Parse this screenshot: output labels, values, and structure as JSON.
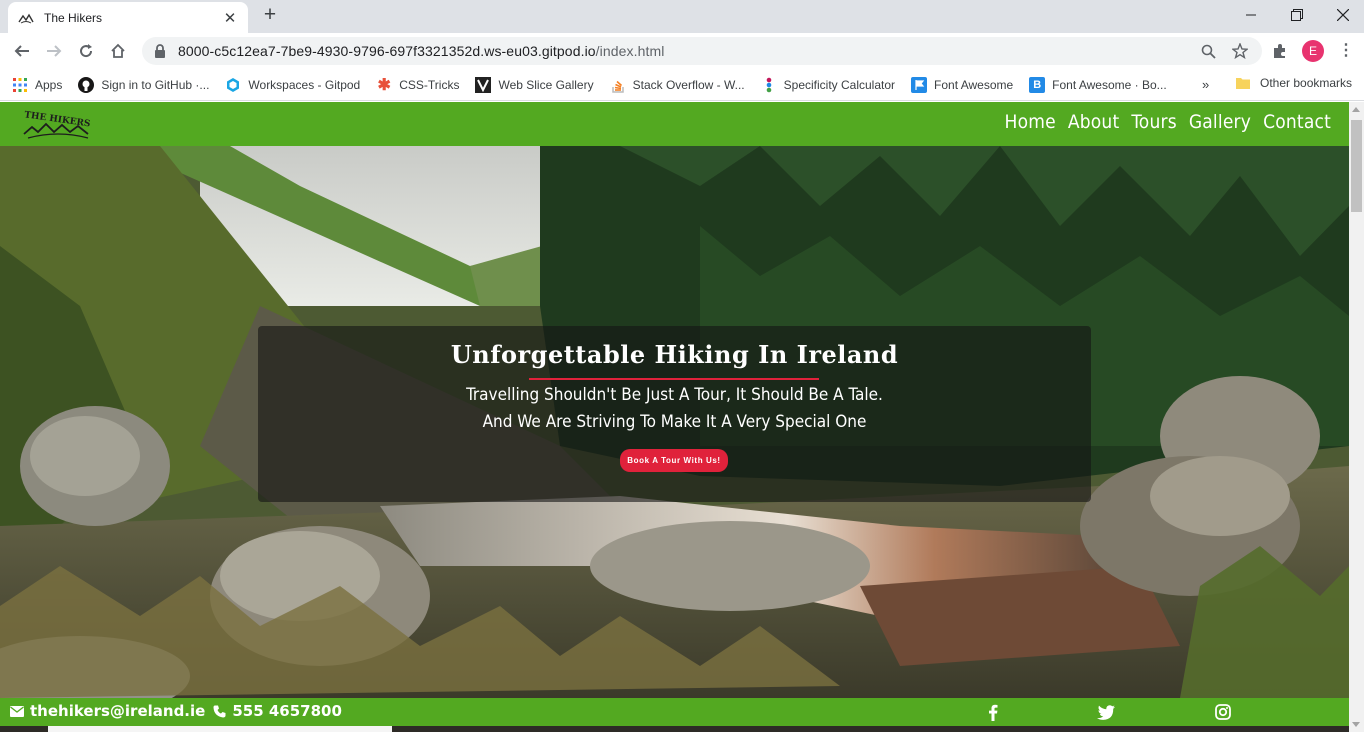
{
  "browser": {
    "tab_title": "The Hikers",
    "url_host": "8000-c5c12ea7-7be9-4930-9796-697f3321352d.ws-eu03.gitpod.io",
    "url_path": "/index.html",
    "avatar_letter": "E",
    "bookmarks": [
      {
        "label": "Apps",
        "icon": "apps-grid-icon"
      },
      {
        "label": "Sign in to GitHub ·...",
        "icon": "github-icon"
      },
      {
        "label": "Workspaces - Gitpod",
        "icon": "gitpod-icon"
      },
      {
        "label": "CSS-Tricks",
        "icon": "css-tricks-icon"
      },
      {
        "label": "Web Slice Gallery",
        "icon": "web-slice-icon"
      },
      {
        "label": "Stack Overflow - W...",
        "icon": "stackoverflow-icon"
      },
      {
        "label": "Specificity Calculator",
        "icon": "specificity-icon"
      },
      {
        "label": "Font Awesome",
        "icon": "font-awesome-flag-icon"
      },
      {
        "label": "Font Awesome · Bo...",
        "icon": "bootstrap-b-icon"
      }
    ],
    "bookmarks_more": "»",
    "other_bookmarks": "Other bookmarks"
  },
  "site": {
    "logo_text": "THE HIKERS",
    "nav": [
      "Home",
      "About",
      "Tours",
      "Gallery",
      "Contact"
    ],
    "hero": {
      "title": "Unforgettable Hiking In Ireland",
      "line1": "Travelling Shouldn't Be Just A Tour, It Should Be A Tale.",
      "line2": "And We Are Striving To Make It A Very Special One",
      "button": "Book A Tour With Us!"
    },
    "footer": {
      "email": "thehikers@ireland.ie",
      "phone": "555 4657800",
      "social": [
        "facebook-icon",
        "twitter-icon",
        "instagram-icon"
      ]
    }
  },
  "colors": {
    "brand_green": "#53a921",
    "accent_red": "#e0223b"
  }
}
